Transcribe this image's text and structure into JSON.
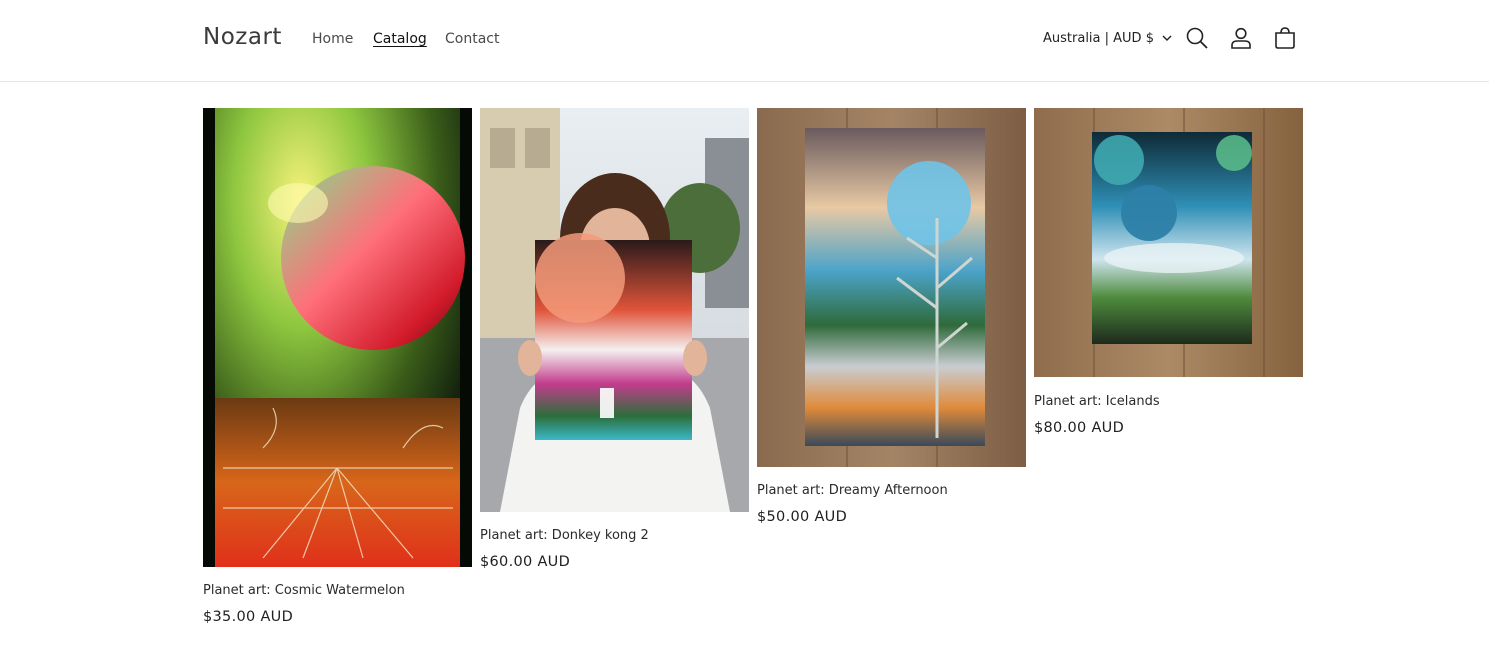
{
  "header": {
    "logo": "Nozart",
    "nav": [
      {
        "label": "Home"
      },
      {
        "label": "Catalog",
        "active": true
      },
      {
        "label": "Contact"
      }
    ],
    "country_selector": "Australia | AUD $",
    "icons": [
      "search-icon",
      "account-icon",
      "cart-icon"
    ]
  },
  "products": [
    {
      "title": "Planet art: Cosmic Watermelon",
      "price": "$35.00 AUD",
      "image": "spray-paint-planet-artwork"
    },
    {
      "title": "Planet art: Donkey kong 2",
      "price": "$60.00 AUD",
      "image": "person-holding-planet-artwork"
    },
    {
      "title": "Planet art: Dreamy Afternoon",
      "price": "$50.00 AUD",
      "image": "spray-paint-tree-artwork"
    },
    {
      "title": "Planet art: Icelands",
      "price": "$80.00 AUD",
      "image": "spray-paint-icelands-artwork"
    }
  ],
  "colors": {
    "text": "#121212",
    "border": "#e6e6e6",
    "background": "#ffffff"
  }
}
